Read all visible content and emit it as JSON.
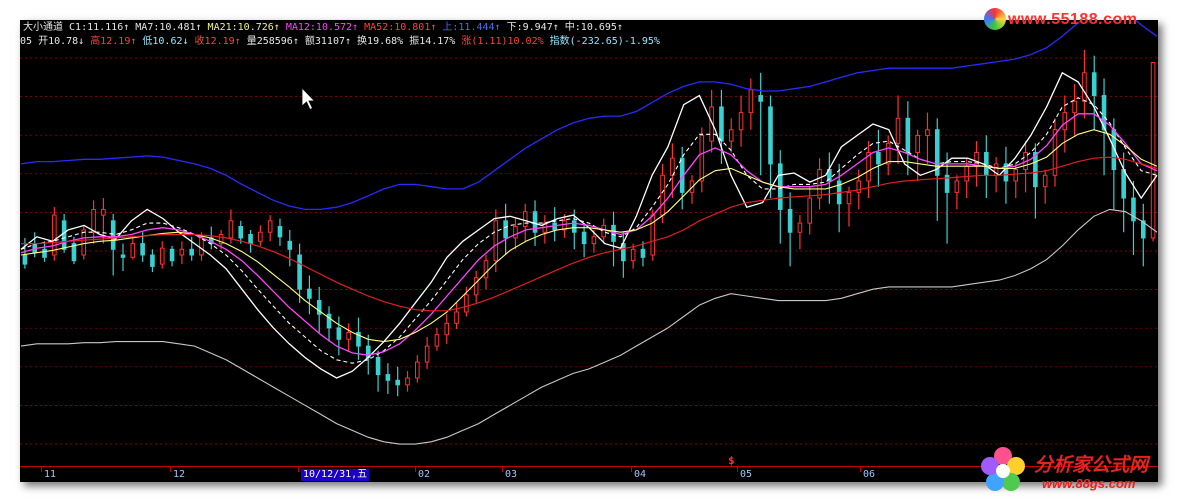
{
  "header": {
    "line1": [
      {
        "text": "大小通道",
        "color": "w"
      },
      {
        "text": "C1:11.116↑",
        "color": "w"
      },
      {
        "text": "MA7:10.481↑",
        "color": "w"
      },
      {
        "text": "MA21:10.726↑",
        "color": "y"
      },
      {
        "text": "MA12:10.572↑",
        "color": "m"
      },
      {
        "text": "MA52:10.801↑",
        "color": "r"
      },
      {
        "text": "上:11.444↑",
        "color": "b"
      },
      {
        "text": "下:9.947↑",
        "color": "w"
      },
      {
        "text": "中:10.695↑",
        "color": "w"
      }
    ],
    "line2": [
      {
        "text": "05",
        "color": "w"
      },
      {
        "text": "开10.78↓",
        "color": "w"
      },
      {
        "text": "高12.19↑",
        "color": "r"
      },
      {
        "text": "低10.62↓",
        "color": "c"
      },
      {
        "text": "收12.19↑",
        "color": "r"
      },
      {
        "text": "量258596↑",
        "color": "w"
      },
      {
        "text": "额31107↑",
        "color": "w"
      },
      {
        "text": "换19.68%",
        "color": "w"
      },
      {
        "text": "振14.17%",
        "color": "w"
      },
      {
        "text": "涨(1.11)10.02%",
        "color": "r"
      },
      {
        "text": "指数(-232.65)-1.95%",
        "color": "c"
      }
    ]
  },
  "x_axis": {
    "labels": [
      "11",
      "12",
      "10/12/31,五",
      "02",
      "03",
      "04",
      "05",
      "06"
    ],
    "selected": "10/12/31,五",
    "marker": "$"
  },
  "watermarks": {
    "top": "www.55188.com",
    "bottom_title": "分析家公式网",
    "bottom_url": "www.88gs.com"
  },
  "colors": {
    "background": "#000000",
    "grid": "#b00000",
    "up": "#ff3030",
    "down": "#38d0d0",
    "upper": "#2a2aff",
    "lower": "#c8c8c8",
    "c1": "#ffffff",
    "ma7": "#ffffff",
    "ma12": "#ff44ff",
    "ma21": "#ffff80",
    "ma52": "#e02020"
  },
  "chart_data": {
    "type": "line",
    "indicator": "大小通道",
    "x_labels": [
      "11",
      "12",
      "10/12/31,五",
      "02",
      "03",
      "04",
      "05",
      "06"
    ],
    "ylim": [
      8.7,
      12.3
    ],
    "grid": "horizontal dashed",
    "candles": [
      [
        10.5,
        10.65,
        10.42,
        10.38
      ],
      [
        10.6,
        10.7,
        10.52,
        10.48
      ],
      [
        10.55,
        10.62,
        10.48,
        10.44
      ],
      [
        10.5,
        10.92,
        10.85,
        10.45
      ],
      [
        10.8,
        10.86,
        10.55,
        10.52
      ],
      [
        10.6,
        10.66,
        10.45,
        10.42
      ],
      [
        10.5,
        10.76,
        10.72,
        10.46
      ],
      [
        10.7,
        10.98,
        10.9,
        10.6
      ],
      [
        10.85,
        11.0,
        10.9,
        10.6
      ],
      [
        10.8,
        10.86,
        10.55,
        10.32
      ],
      [
        10.5,
        10.6,
        10.48,
        10.36
      ],
      [
        10.48,
        10.66,
        10.6,
        10.46
      ],
      [
        10.6,
        10.7,
        10.5,
        10.44
      ],
      [
        10.5,
        10.55,
        10.4,
        10.35
      ],
      [
        10.42,
        10.62,
        10.56,
        10.38
      ],
      [
        10.55,
        10.58,
        10.45,
        10.4
      ],
      [
        10.5,
        10.62,
        10.55,
        10.42
      ],
      [
        10.55,
        10.66,
        10.5,
        10.45
      ],
      [
        10.5,
        10.7,
        10.65,
        10.45
      ],
      [
        10.65,
        10.75,
        10.6,
        10.55
      ],
      [
        10.6,
        10.72,
        10.68,
        10.55
      ],
      [
        10.65,
        10.9,
        10.8,
        10.6
      ],
      [
        10.75,
        10.8,
        10.65,
        10.6
      ],
      [
        10.68,
        10.72,
        10.6,
        10.52
      ],
      [
        10.62,
        10.76,
        10.7,
        10.58
      ],
      [
        10.7,
        10.85,
        10.8,
        10.62
      ],
      [
        10.75,
        10.82,
        10.66,
        10.58
      ],
      [
        10.62,
        10.72,
        10.55,
        10.4
      ],
      [
        10.5,
        10.6,
        10.2,
        10.08
      ],
      [
        10.2,
        10.32,
        10.12,
        9.98
      ],
      [
        10.1,
        10.22,
        9.98,
        9.82
      ],
      [
        9.98,
        10.05,
        9.86,
        9.74
      ],
      [
        9.86,
        9.96,
        9.76,
        9.62
      ],
      [
        9.76,
        9.9,
        9.82,
        9.66
      ],
      [
        9.82,
        9.95,
        9.7,
        9.58
      ],
      [
        9.7,
        9.8,
        9.6,
        9.45
      ],
      [
        9.6,
        9.66,
        9.45,
        9.3
      ],
      [
        9.45,
        9.55,
        9.4,
        9.28
      ],
      [
        9.4,
        9.52,
        9.36,
        9.26
      ],
      [
        9.36,
        9.48,
        9.42,
        9.3
      ],
      [
        9.42,
        9.62,
        9.56,
        9.38
      ],
      [
        9.56,
        9.78,
        9.7,
        9.5
      ],
      [
        9.7,
        9.86,
        9.8,
        9.66
      ],
      [
        9.8,
        9.98,
        9.9,
        9.72
      ],
      [
        9.9,
        10.08,
        10.0,
        9.85
      ],
      [
        10.0,
        10.22,
        10.15,
        9.96
      ],
      [
        10.15,
        10.36,
        10.3,
        10.08
      ],
      [
        10.3,
        10.5,
        10.45,
        10.2
      ],
      [
        10.45,
        10.9,
        10.8,
        10.35
      ],
      [
        10.8,
        10.95,
        10.65,
        10.5
      ],
      [
        10.65,
        10.82,
        10.75,
        10.55
      ],
      [
        10.75,
        10.95,
        10.88,
        10.62
      ],
      [
        10.88,
        10.98,
        10.7,
        10.58
      ],
      [
        10.7,
        10.85,
        10.78,
        10.6
      ],
      [
        10.78,
        10.92,
        10.72,
        10.62
      ],
      [
        10.72,
        10.86,
        10.8,
        10.65
      ],
      [
        10.8,
        10.9,
        10.7,
        10.55
      ],
      [
        10.7,
        10.78,
        10.6,
        10.48
      ],
      [
        10.6,
        10.72,
        10.66,
        10.52
      ],
      [
        10.66,
        10.82,
        10.76,
        10.6
      ],
      [
        10.76,
        10.88,
        10.62,
        10.4
      ],
      [
        10.6,
        10.7,
        10.45,
        10.3
      ],
      [
        10.45,
        10.6,
        10.55,
        10.38
      ],
      [
        10.55,
        10.62,
        10.48,
        10.4
      ],
      [
        10.5,
        10.9,
        10.85,
        10.45
      ],
      [
        10.85,
        11.3,
        11.2,
        10.78
      ],
      [
        11.2,
        11.48,
        11.35,
        11.0
      ],
      [
        11.35,
        11.45,
        11.05,
        10.9
      ],
      [
        11.05,
        11.2,
        11.15,
        10.95
      ],
      [
        11.15,
        11.62,
        11.55,
        11.05
      ],
      [
        11.5,
        11.95,
        11.8,
        11.4
      ],
      [
        11.8,
        11.95,
        11.5,
        11.3
      ],
      [
        11.5,
        11.7,
        11.6,
        11.4
      ],
      [
        11.6,
        11.9,
        11.75,
        11.45
      ],
      [
        11.75,
        12.05,
        11.95,
        11.6
      ],
      [
        11.9,
        12.1,
        11.85,
        11.2
      ],
      [
        11.8,
        11.9,
        11.3,
        11.0
      ],
      [
        11.3,
        11.42,
        10.9,
        10.6
      ],
      [
        10.9,
        11.05,
        10.7,
        10.4
      ],
      [
        10.7,
        10.85,
        10.78,
        10.55
      ],
      [
        10.78,
        11.1,
        11.0,
        10.68
      ],
      [
        11.0,
        11.35,
        11.25,
        10.9
      ],
      [
        11.25,
        11.4,
        11.15,
        10.95
      ],
      [
        11.15,
        11.3,
        10.95,
        10.7
      ],
      [
        10.95,
        11.1,
        11.05,
        10.75
      ],
      [
        11.05,
        11.25,
        11.15,
        10.9
      ],
      [
        11.15,
        11.5,
        11.4,
        11.0
      ],
      [
        11.4,
        11.6,
        11.3,
        11.1
      ],
      [
        11.3,
        11.55,
        11.48,
        11.2
      ],
      [
        11.48,
        11.9,
        11.7,
        11.3
      ],
      [
        11.7,
        11.85,
        11.4,
        11.2
      ],
      [
        11.4,
        11.6,
        11.55,
        11.15
      ],
      [
        11.55,
        11.75,
        11.6,
        11.3
      ],
      [
        11.6,
        11.7,
        11.2,
        10.8
      ],
      [
        11.2,
        11.4,
        11.05,
        10.6
      ],
      [
        11.05,
        11.2,
        11.15,
        10.9
      ],
      [
        11.15,
        11.35,
        11.28,
        11.0
      ],
      [
        11.28,
        11.5,
        11.4,
        11.1
      ],
      [
        11.4,
        11.55,
        11.2,
        11.0
      ],
      [
        11.2,
        11.36,
        11.3,
        11.05
      ],
      [
        11.3,
        11.45,
        11.15,
        10.95
      ],
      [
        11.15,
        11.3,
        11.25,
        11.0
      ],
      [
        11.25,
        11.5,
        11.4,
        11.05
      ],
      [
        11.4,
        11.48,
        11.1,
        10.82
      ],
      [
        11.1,
        11.25,
        11.2,
        10.95
      ],
      [
        11.2,
        11.7,
        11.6,
        11.1
      ],
      [
        11.6,
        11.9,
        11.75,
        11.4
      ],
      [
        11.75,
        12.0,
        11.85,
        11.55
      ],
      [
        11.85,
        12.3,
        12.1,
        11.7
      ],
      [
        12.1,
        12.25,
        11.9,
        11.6
      ],
      [
        11.9,
        12.05,
        11.6,
        11.2
      ],
      [
        11.6,
        11.7,
        11.25,
        10.9
      ],
      [
        11.25,
        11.4,
        11.0,
        10.7
      ],
      [
        11.0,
        11.15,
        10.8,
        10.5
      ],
      [
        10.8,
        10.95,
        10.65,
        10.4
      ],
      [
        10.65,
        12.19,
        12.19,
        10.62
      ]
    ],
    "series": [
      {
        "name": "C1",
        "values": [
          10.55,
          10.66,
          10.62,
          10.72,
          10.76,
          10.68,
          10.64,
          10.8,
          10.9,
          10.82,
          10.7,
          10.6,
          10.5,
          10.38,
          10.2,
          10.02,
          9.86,
          9.72,
          9.6,
          9.5,
          9.42,
          9.48,
          9.6,
          9.74,
          9.9,
          10.08,
          10.26,
          10.48,
          10.62,
          10.72,
          10.82,
          10.84,
          10.8,
          10.76,
          10.82,
          10.85,
          10.74,
          10.6,
          10.56,
          10.84,
          11.2,
          11.45,
          11.82,
          11.9,
          11.6,
          11.2,
          10.92,
          10.96,
          11.2,
          11.22,
          11.14,
          11.2,
          11.45,
          11.55,
          11.65,
          11.6,
          11.3,
          11.2,
          11.25,
          11.35,
          11.35,
          11.3,
          11.2,
          11.35,
          11.55,
          11.8,
          12.1,
          12.02,
          11.8,
          11.52,
          11.22,
          11.0,
          11.2
        ]
      },
      {
        "name": "MA7",
        "values": [
          10.55,
          10.6,
          10.62,
          10.66,
          10.7,
          10.7,
          10.68,
          10.72,
          10.78,
          10.78,
          10.74,
          10.68,
          10.6,
          10.5,
          10.36,
          10.2,
          10.05,
          9.9,
          9.78,
          9.66,
          9.58,
          9.55,
          9.58,
          9.66,
          9.78,
          9.94,
          10.1,
          10.28,
          10.46,
          10.6,
          10.7,
          10.76,
          10.78,
          10.78,
          10.8,
          10.82,
          10.78,
          10.7,
          10.66,
          10.74,
          10.92,
          11.12,
          11.38,
          11.56,
          11.56,
          11.42,
          11.2,
          11.08,
          11.08,
          11.12,
          11.12,
          11.14,
          11.26,
          11.38,
          11.48,
          11.5,
          11.42,
          11.34,
          11.3,
          11.32,
          11.32,
          11.3,
          11.26,
          11.3,
          11.4,
          11.56,
          11.8,
          11.88,
          11.82,
          11.66,
          11.44,
          11.24,
          11.2
        ]
      },
      {
        "name": "MA12",
        "values": [
          10.52,
          10.56,
          10.58,
          10.62,
          10.65,
          10.66,
          10.66,
          10.68,
          10.72,
          10.74,
          10.72,
          10.68,
          10.62,
          10.55,
          10.45,
          10.32,
          10.18,
          10.04,
          9.92,
          9.8,
          9.7,
          9.64,
          9.62,
          9.65,
          9.72,
          9.84,
          9.98,
          10.14,
          10.3,
          10.46,
          10.58,
          10.66,
          10.72,
          10.74,
          10.76,
          10.78,
          10.76,
          10.72,
          10.68,
          10.72,
          10.84,
          11.0,
          11.2,
          11.38,
          11.44,
          11.38,
          11.24,
          11.14,
          11.1,
          11.1,
          11.1,
          11.12,
          11.2,
          11.3,
          11.4,
          11.44,
          11.4,
          11.34,
          11.3,
          11.3,
          11.3,
          11.28,
          11.26,
          11.28,
          11.34,
          11.46,
          11.64,
          11.74,
          11.74,
          11.64,
          11.48,
          11.3,
          11.24
        ]
      },
      {
        "name": "MA21",
        "values": [
          10.5,
          10.52,
          10.54,
          10.57,
          10.6,
          10.62,
          10.63,
          10.65,
          10.67,
          10.69,
          10.7,
          10.68,
          10.65,
          10.6,
          10.53,
          10.44,
          10.33,
          10.22,
          10.1,
          10.0,
          9.9,
          9.82,
          9.76,
          9.74,
          9.76,
          9.82,
          9.9,
          10.0,
          10.14,
          10.28,
          10.42,
          10.54,
          10.62,
          10.68,
          10.72,
          10.74,
          10.74,
          10.72,
          10.7,
          10.72,
          10.78,
          10.88,
          11.02,
          11.16,
          11.24,
          11.26,
          11.2,
          11.14,
          11.1,
          11.08,
          11.08,
          11.08,
          11.12,
          11.18,
          11.26,
          11.32,
          11.32,
          11.3,
          11.28,
          11.28,
          11.28,
          11.28,
          11.26,
          11.26,
          11.3,
          11.36,
          11.48,
          11.56,
          11.6,
          11.56,
          11.46,
          11.34,
          11.28
        ]
      },
      {
        "name": "MA52",
        "values": [
          10.6,
          10.6,
          10.61,
          10.62,
          10.63,
          10.64,
          10.65,
          10.66,
          10.67,
          10.68,
          10.68,
          10.68,
          10.67,
          10.65,
          10.62,
          10.58,
          10.53,
          10.47,
          10.4,
          10.33,
          10.26,
          10.2,
          10.14,
          10.09,
          10.05,
          10.02,
          10.01,
          10.01,
          10.04,
          10.08,
          10.13,
          10.19,
          10.25,
          10.31,
          10.37,
          10.43,
          10.48,
          10.52,
          10.55,
          10.58,
          10.62,
          10.66,
          10.72,
          10.8,
          10.86,
          10.92,
          10.96,
          10.98,
          11.0,
          11.01,
          11.02,
          11.03,
          11.05,
          11.07,
          11.1,
          11.13,
          11.15,
          11.16,
          11.17,
          11.18,
          11.19,
          11.2,
          11.2,
          11.21,
          11.22,
          11.24,
          11.28,
          11.32,
          11.35,
          11.36,
          11.34,
          11.3,
          11.26
        ]
      },
      {
        "name": "上",
        "values": [
          11.3,
          11.32,
          11.32,
          11.33,
          11.34,
          11.34,
          11.35,
          11.36,
          11.37,
          11.36,
          11.33,
          11.3,
          11.26,
          11.2,
          11.12,
          11.05,
          10.98,
          10.93,
          10.9,
          10.9,
          10.92,
          10.96,
          11.02,
          11.08,
          11.12,
          11.12,
          11.1,
          11.08,
          11.08,
          11.14,
          11.24,
          11.34,
          11.44,
          11.52,
          11.6,
          11.66,
          11.7,
          11.72,
          11.72,
          11.76,
          11.84,
          11.92,
          11.98,
          12.02,
          12.02,
          12.0,
          11.96,
          11.94,
          11.94,
          11.96,
          11.98,
          12.02,
          12.06,
          12.1,
          12.12,
          12.14,
          12.14,
          12.14,
          12.14,
          12.14,
          12.16,
          12.18,
          12.2,
          12.22,
          12.26,
          12.32,
          12.42,
          12.54,
          12.64,
          12.68,
          12.64,
          12.52,
          12.42
        ]
      },
      {
        "name": "下",
        "values": [
          9.7,
          9.72,
          9.72,
          9.72,
          9.73,
          9.73,
          9.74,
          9.74,
          9.74,
          9.74,
          9.72,
          9.7,
          9.64,
          9.58,
          9.5,
          9.42,
          9.34,
          9.26,
          9.18,
          9.1,
          9.02,
          8.96,
          8.9,
          8.86,
          8.84,
          8.84,
          8.86,
          8.9,
          8.96,
          9.02,
          9.1,
          9.18,
          9.26,
          9.34,
          9.4,
          9.46,
          9.5,
          9.56,
          9.62,
          9.7,
          9.78,
          9.86,
          9.96,
          10.06,
          10.12,
          10.16,
          10.14,
          10.12,
          10.1,
          10.1,
          10.1,
          10.1,
          10.12,
          10.16,
          10.2,
          10.22,
          10.22,
          10.22,
          10.22,
          10.22,
          10.24,
          10.26,
          10.28,
          10.32,
          10.38,
          10.46,
          10.58,
          10.72,
          10.84,
          10.9,
          10.88,
          10.8,
          10.7
        ]
      }
    ]
  }
}
